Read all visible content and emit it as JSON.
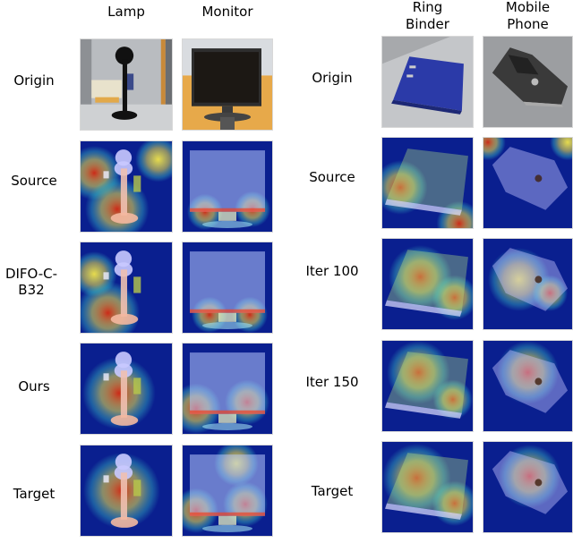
{
  "left_panel": {
    "columns": [
      "Lamp",
      "Monitor"
    ],
    "rows": [
      "Origin",
      "Source",
      "DIFO-C-\nB32",
      "Ours",
      "Target"
    ]
  },
  "right_panel": {
    "columns": [
      "Ring\nBinder",
      "Mobile\nPhone"
    ],
    "rows": [
      "Origin",
      "Source",
      "Iter 100",
      "Iter 150",
      "Target"
    ]
  },
  "tiles": {
    "lamp": [
      "photo",
      "heatmap-source",
      "heatmap-difo",
      "heatmap-ours",
      "heatmap-target"
    ],
    "monitor": [
      "photo",
      "heatmap-source",
      "heatmap-difo",
      "heatmap-ours",
      "heatmap-target"
    ],
    "binder": [
      "photo",
      "heatmap-source",
      "heatmap-iter100",
      "heatmap-iter150",
      "heatmap-target"
    ],
    "phone": [
      "photo",
      "heatmap-source",
      "heatmap-iter100",
      "heatmap-iter150",
      "heatmap-target"
    ]
  },
  "colors": {
    "heat_low": "#0a1f8f",
    "heat_mid": "#3fd2c8",
    "heat_warm": "#f2e54a",
    "heat_high": "#d62a12",
    "binder_blue": "#2b3aa8",
    "monitor_desk": "#e7a94a"
  }
}
